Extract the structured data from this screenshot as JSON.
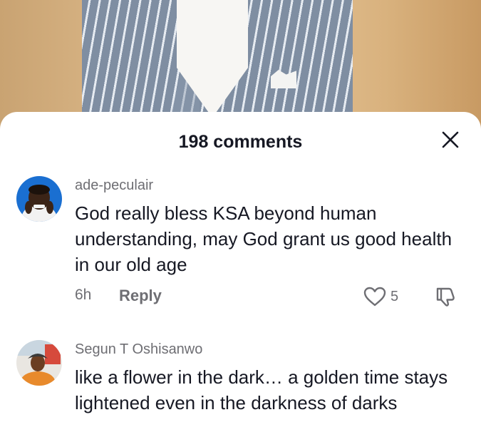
{
  "header": {
    "comments_count_label": "198 comments"
  },
  "comments": [
    {
      "username": "ade-peculair",
      "text": "God really bless KSA beyond human understanding, may God grant us good health in our old age",
      "time": "6h",
      "reply_label": "Reply",
      "likes": "5"
    },
    {
      "username": "Segun T Oshisanwo",
      "text": "like a flower in the dark… a golden time stays lightened even in the darkness of darks"
    }
  ],
  "colors": {
    "primary_text": "#161823",
    "secondary_text": "#6e6e73",
    "sheet_bg": "#ffffff"
  },
  "icons": {
    "close": "close-icon",
    "like": "heart-icon",
    "dislike": "thumbs-down-icon"
  }
}
